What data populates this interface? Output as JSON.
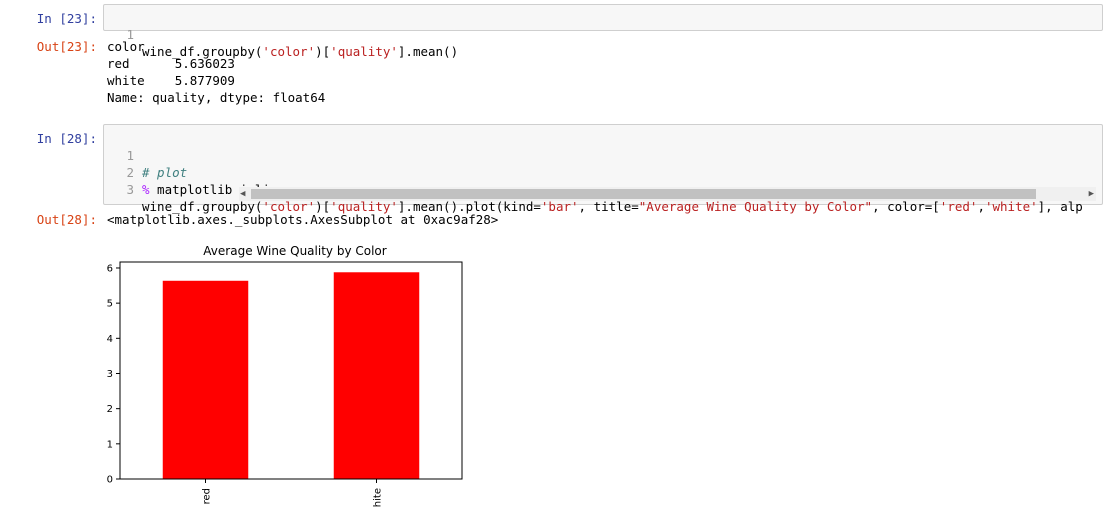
{
  "cells": {
    "c23_in_prompt": "In [23]:",
    "c23_code_lineno": "1",
    "c23_code_a": "wine_df.groupby(",
    "c23_code_s1": "'color'",
    "c23_code_b": ")[",
    "c23_code_s2": "'quality'",
    "c23_code_c": "].mean()",
    "c23_out_prompt": "Out[23]:",
    "c23_out_line1": "color",
    "c23_out_line2": "red      5.636023",
    "c23_out_line3": "white    5.877909",
    "c23_out_line4": "Name: quality, dtype: float64",
    "c28_in_prompt": "In [28]:",
    "c28_l1_no": "1",
    "c28_l1": "# plot",
    "c28_l2_no": "2",
    "c28_l2_magic": "%",
    "c28_l2_rest": " matplotlib inline",
    "c28_l3_no": "3",
    "c28_l3_a": "wine_df.groupby(",
    "c28_l3_s1": "'color'",
    "c28_l3_b": ")[",
    "c28_l3_s2": "'quality'",
    "c28_l3_c": "].mean().plot(kind=",
    "c28_l3_s3": "'bar'",
    "c28_l3_d": ", title=",
    "c28_l3_s4": "\"Average Wine Quality by Color\"",
    "c28_l3_e": ", color=[",
    "c28_l3_s5": "'red'",
    "c28_l3_f": ",",
    "c28_l3_s6": "'white'",
    "c28_l3_g": "], alp",
    "c28_out_prompt": "Out[28]:",
    "c28_out_text": "<matplotlib.axes._subplots.AxesSubplot at 0xac9af28>"
  },
  "chart_data": {
    "type": "bar",
    "title": "Average Wine Quality by Color",
    "categories": [
      "red",
      "hite"
    ],
    "values": [
      5.636023,
      5.877909
    ],
    "colors": [
      "#ff0000",
      "#ff0000"
    ],
    "yticks": [
      "0",
      "1",
      "2",
      "3",
      "4",
      "5",
      "6"
    ],
    "ylim": [
      0,
      6.17
    ],
    "xlabel": "",
    "ylabel": "",
    "grid": false,
    "legend": false
  }
}
